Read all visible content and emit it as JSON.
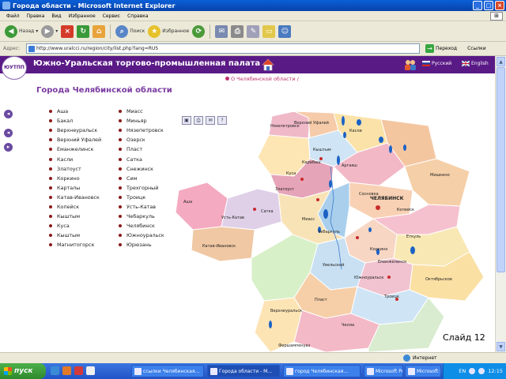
{
  "window": {
    "title": "Города области - Microsoft Internet Explorer",
    "buttons": [
      "_",
      "□",
      "×"
    ]
  },
  "menu": [
    "Файл",
    "Правка",
    "Вид",
    "Избранное",
    "Сервис",
    "Справка"
  ],
  "toolbar": {
    "back": "Назад",
    "search": "Поиск",
    "favorites": "Избранное"
  },
  "address": {
    "label": "Адрес:",
    "url": "http://www.uralcci.ru/region/city/list.php?lang=RUS",
    "go_label": "Переход",
    "links_label": "Ссылки"
  },
  "site": {
    "title": "Южно-Уральская торгово-промышленная палата",
    "lang_ru": "Русский",
    "lang_en": "English",
    "breadcrumb": "О Челябинской области /",
    "page_title": "Города Челябинской области"
  },
  "cities_col1": [
    "Аша",
    "Бакал",
    "Верхнеуральск",
    "Верхний Уфалей",
    "Еманжелинск",
    "Касли",
    "Златоуст",
    "Коркино",
    "Карталы",
    "Катав-Ивановск",
    "Копейск",
    "Кыштым",
    "Куса",
    "Кыштым",
    "Магнитогорск"
  ],
  "cities_col2": [
    "Миасс",
    "Миньяр",
    "Нязепетровск",
    "Озерск",
    "Пласт",
    "Сатка",
    "Снежинск",
    "Сим",
    "Трехгорный",
    "Троицк",
    "Усть-Катав",
    "Чебаркуль",
    "Челябинск",
    "Южноуральск",
    "Юрюзань"
  ],
  "map_labels": {
    "nyazepetrovsk": "Нязепетровск",
    "verkhny_ufaley": "Верхний Уфалей",
    "kasli": "Касли",
    "kyshtym": "Кыштым",
    "karabash": "Карабаш",
    "kusa": "Куса",
    "zlatoust": "Златоуст",
    "argayash": "Аргаяш",
    "sosnovka": "Сосновка",
    "chelyabinsk": "ЧЕЛЯБИНСК",
    "kopeysk": "Копейск",
    "mamysh": "Мишкино",
    "asha": "Аша",
    "satka": "Сатка",
    "ust_katav": "Усть-Катав",
    "katav_ivanovsk": "Катав-Ивановск",
    "miass": "Миасс",
    "chebarkul": "Чебаркуль",
    "korkino": "Коркино",
    "emanzhelinsk": "Еманжелинск",
    "etkul": "Еткуль",
    "yuzhnouralsk": "Южноуральск",
    "oktyabrskoe": "Октябрьское",
    "troitsk": "Троицк",
    "uvelka": "Увельский",
    "verkhneuralsk": "Верхнеуральск",
    "plast": "Пласт",
    "chesma": "Чесма",
    "fershampenuaz": "Фершампенуаз"
  },
  "slide_label": "Слайд 12",
  "status": {
    "zone": "Интернет"
  },
  "taskbar": {
    "start": "пуск",
    "tasks": [
      "ссылки Челябинская...",
      "Города области - М...",
      "город Челябинская...",
      "Microsoft PowerPoint...",
      "Microsoft PowerPoint..."
    ],
    "lang": "EN",
    "time": "12:15"
  },
  "colors": {
    "header_bg": "#5a1a86",
    "title_color": "#7a3aa0",
    "breadcrumb": "#c0306f"
  }
}
